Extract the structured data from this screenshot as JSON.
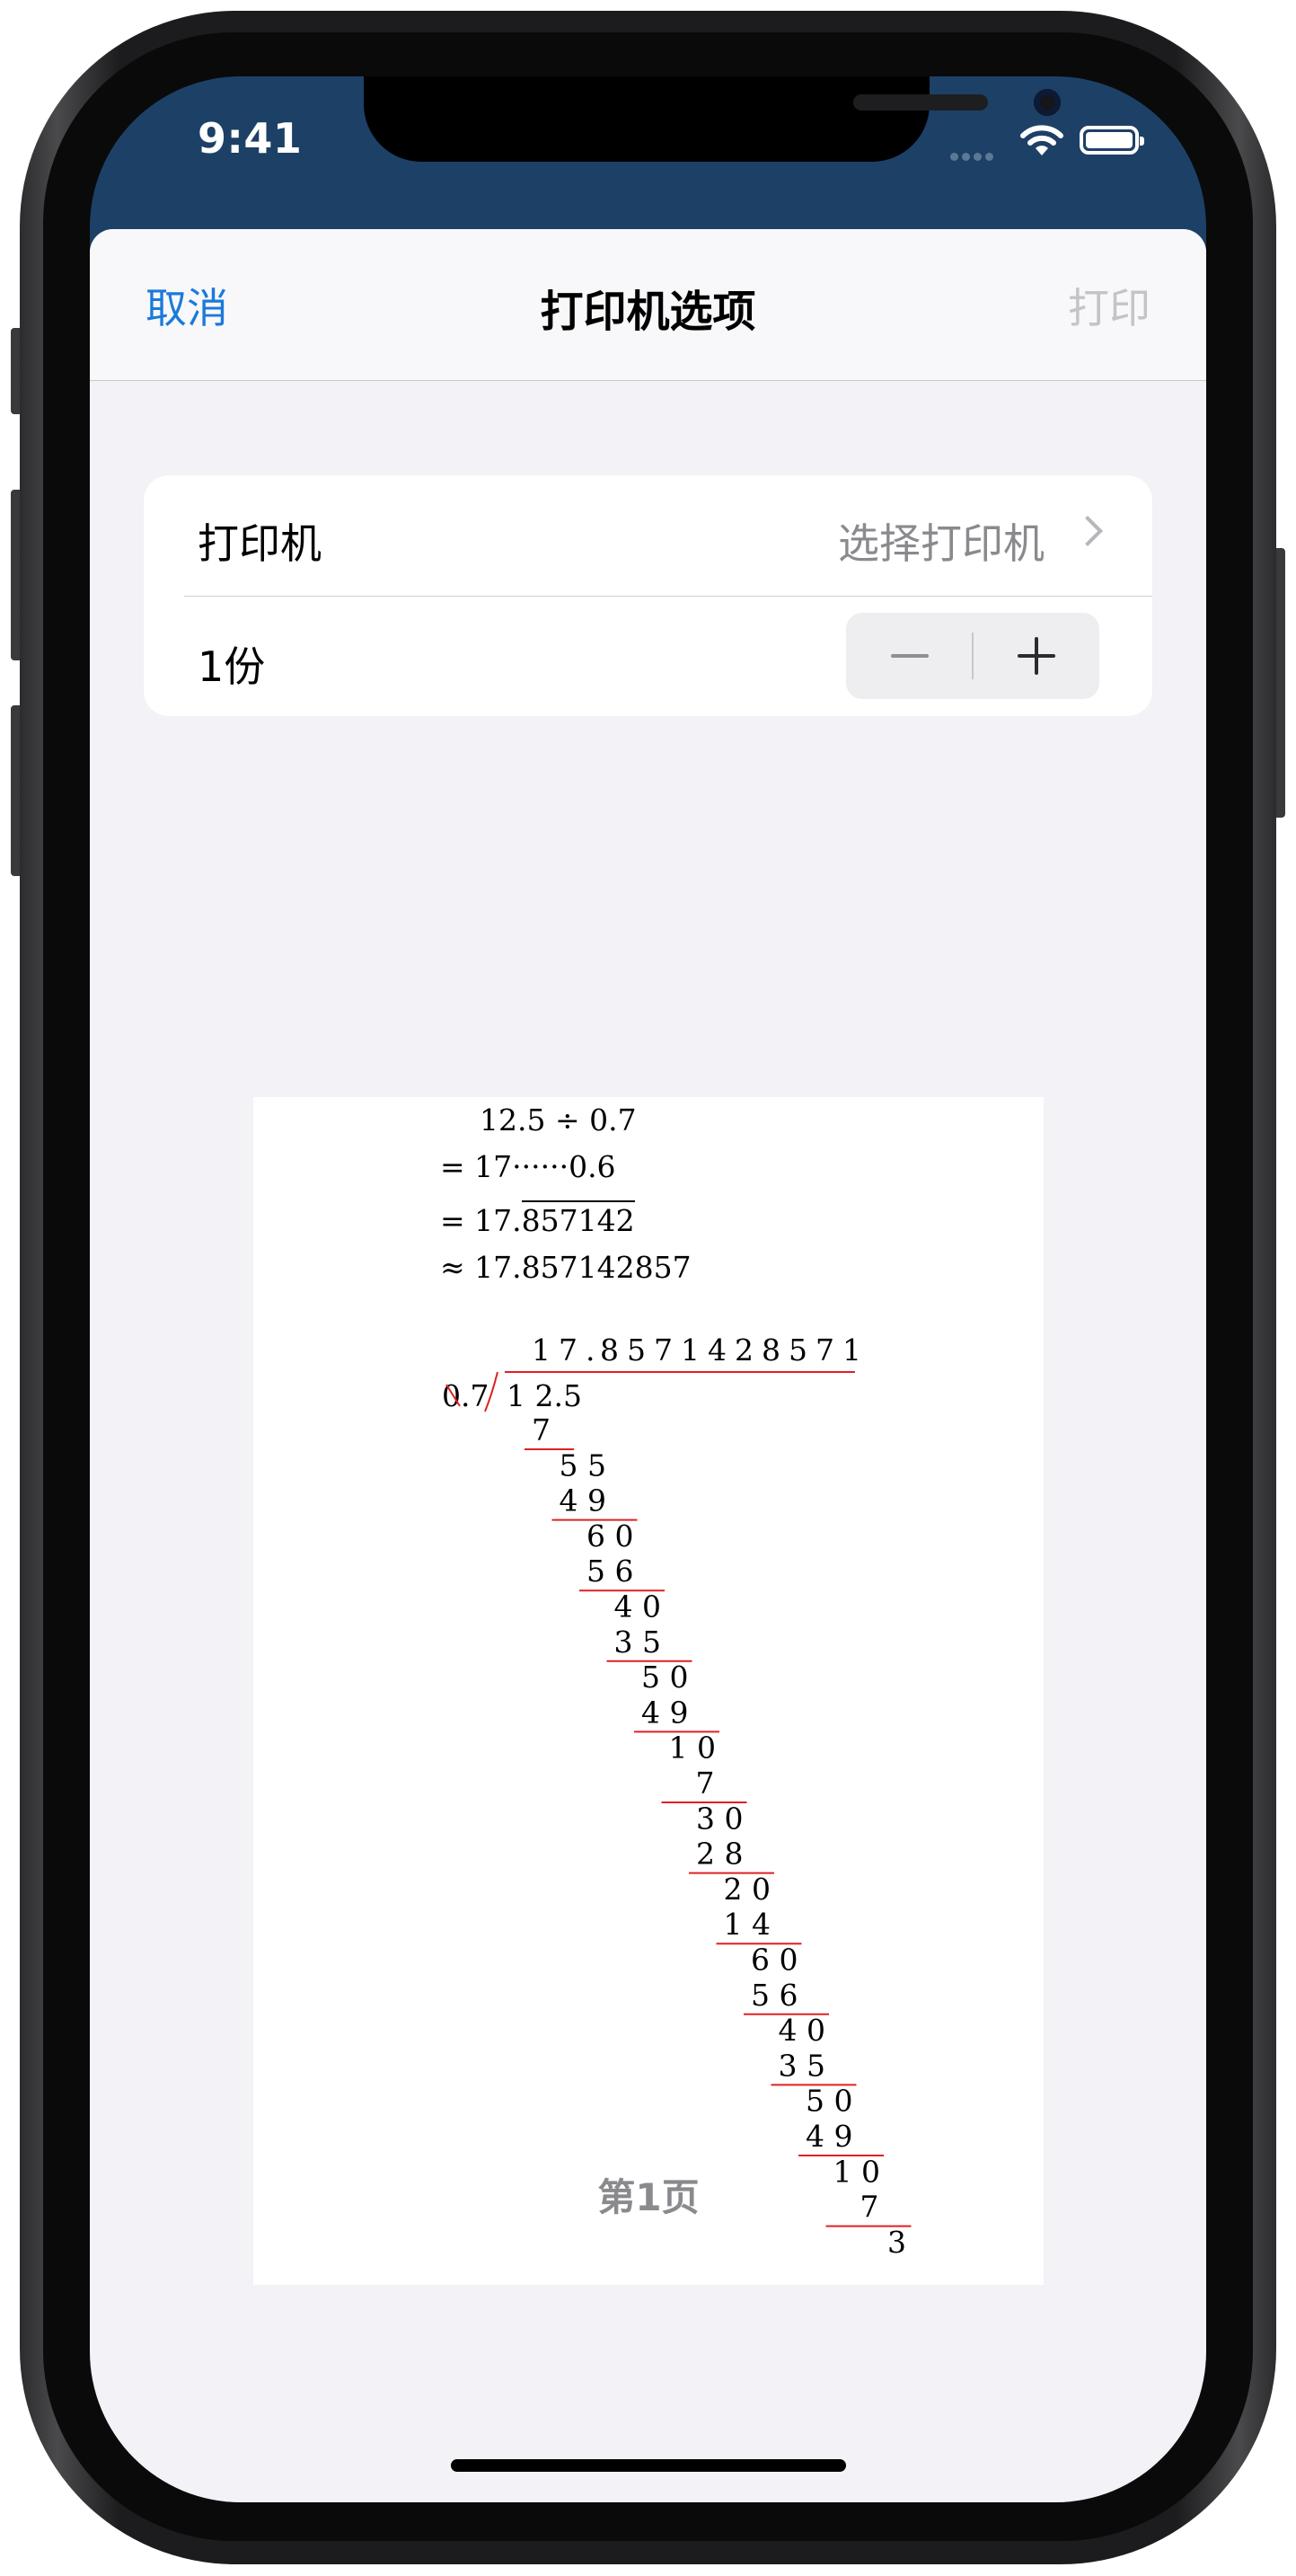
{
  "status_bar": {
    "time": "9:41"
  },
  "nav": {
    "cancel_label": "取消",
    "title": "打印机选项",
    "print_label": "打印"
  },
  "settings": {
    "printer_label": "打印机",
    "printer_value": "选择打印机",
    "copies_label": "1份"
  },
  "preview": {
    "equations": [
      "12.5 ÷ 0.7",
      "= 17······0.6",
      "= 17.",
      "857142",
      "≈ 17.857142857"
    ],
    "quotient_digits": [
      "1",
      "7",
      ".",
      "8",
      "5",
      "7",
      "1",
      "4",
      "2",
      "8",
      "5",
      "7",
      "1"
    ],
    "divisor": "0.7",
    "dividend": "1 2.5",
    "steps": [
      "7",
      "5 5",
      "4 9",
      "6 0",
      "5 6",
      "4 0",
      "3 5",
      "5 0",
      "4 9",
      "1 0",
      "7",
      "3 0",
      "2 8",
      "2 0",
      "1 4",
      "6 0",
      "5 6",
      "4 0",
      "3 5",
      "5 0",
      "4 9",
      "1 0",
      "7",
      "3"
    ],
    "page_label": "第1页"
  },
  "colors": {
    "nav_accent": "#1b7ada",
    "status_bar_bg": "#1d4066",
    "division_line": "#e02020"
  }
}
